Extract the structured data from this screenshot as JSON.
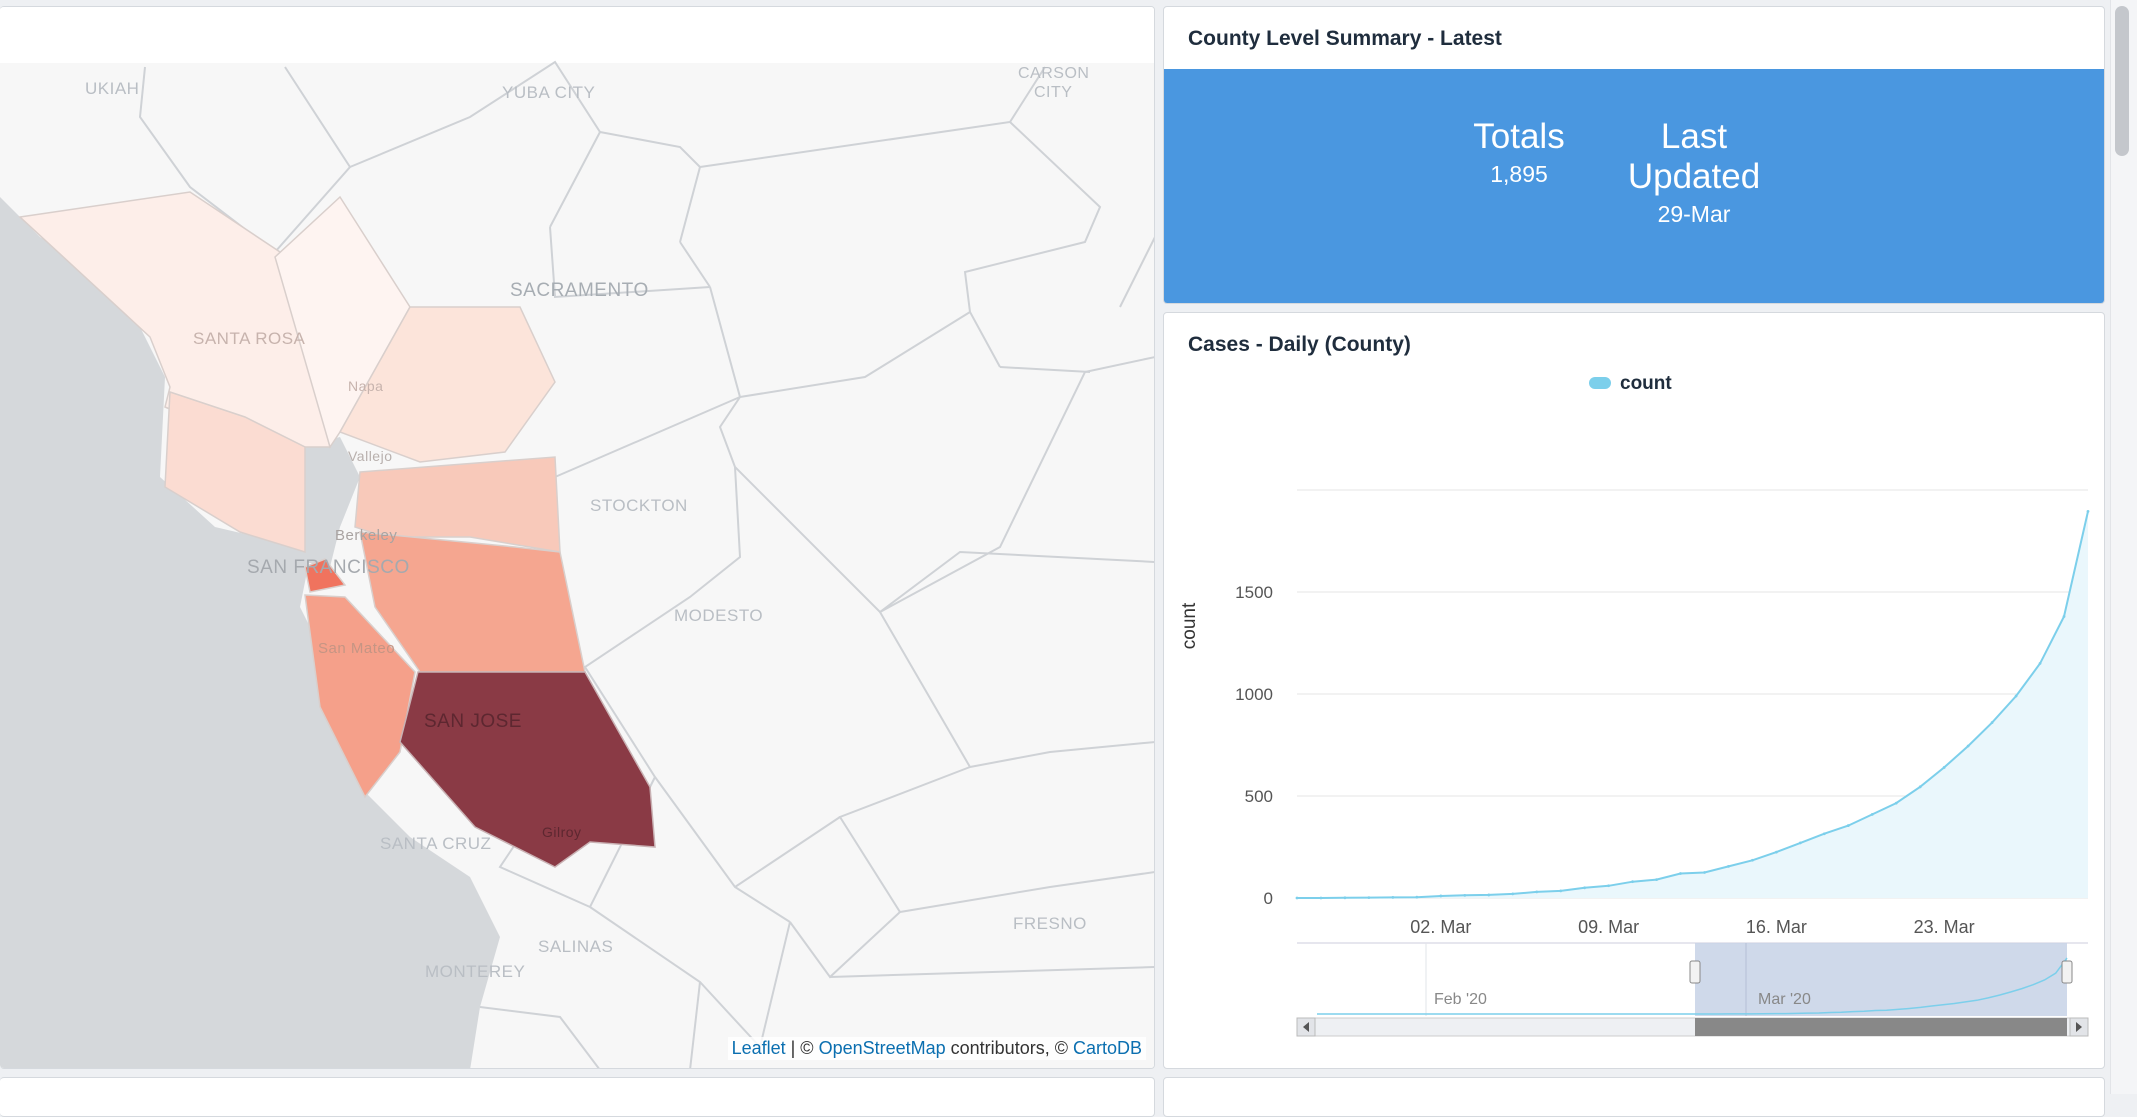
{
  "map": {
    "cities": [
      "UKIAH",
      "YUBA CITY",
      "CARSON",
      "CITY",
      "SACRAMENTO",
      "SANTA ROSA",
      "Napa",
      "Vallejo",
      "Berkeley",
      "SAN FRANCISCO",
      "STOCKTON",
      "MODESTO",
      "San Mateo",
      "SAN JOSE",
      "Gilroy",
      "SANTA CRUZ",
      "SALINAS",
      "MONTEREY",
      "FRESNO"
    ],
    "attribution": {
      "leaflet": "Leaflet",
      "sep1": " | © ",
      "osm": "OpenStreetMap",
      "contrib": " contributors, © ",
      "carto": "CartoDB"
    },
    "colors": {
      "land": "#f7f7f7",
      "water": "#d5d8db",
      "border": "#cfd2d6",
      "lightest": "#fdeee9",
      "light": "#fbdcd2",
      "medium": "#f8c4b4",
      "strong": "#f4a38d",
      "hot": "#f0735e",
      "darkest": "#8a3a45"
    }
  },
  "summary": {
    "title": "County Level Summary - Latest",
    "totals_label": "Totals",
    "totals_value": "1,895",
    "updated_label": "Last Updated",
    "updated_value": "29-Mar",
    "bg_color": "#4a97e0"
  },
  "chart_panel": {
    "title": "Cases - Daily (County)"
  },
  "chart_data": {
    "type": "area",
    "legend": "count",
    "ylabel": "count",
    "ylim": [
      0,
      2000
    ],
    "yticks": [
      0,
      500,
      1000,
      1500
    ],
    "xtick_labels": [
      "02. Mar",
      "09. Mar",
      "16. Mar",
      "23. Mar"
    ],
    "navigator_labels": [
      "Feb '20",
      "Mar '20"
    ],
    "series": [
      {
        "name": "count",
        "color": "#7ccfeb",
        "x": [
          "25-Feb",
          "26-Feb",
          "27-Feb",
          "28-Feb",
          "29-Feb",
          "01-Mar",
          "02-Mar",
          "03-Mar",
          "04-Mar",
          "05-Mar",
          "06-Mar",
          "07-Mar",
          "08-Mar",
          "09-Mar",
          "10-Mar",
          "11-Mar",
          "12-Mar",
          "13-Mar",
          "14-Mar",
          "15-Mar",
          "16-Mar",
          "17-Mar",
          "18-Mar",
          "19-Mar",
          "20-Mar",
          "21-Mar",
          "22-Mar",
          "23-Mar",
          "24-Mar",
          "25-Mar",
          "26-Mar",
          "27-Mar",
          "28-Mar",
          "29-Mar"
        ],
        "values": [
          0,
          0,
          1,
          2,
          3,
          4,
          10,
          13,
          15,
          20,
          30,
          35,
          50,
          60,
          80,
          90,
          120,
          125,
          155,
          185,
          225,
          270,
          315,
          355,
          410,
          465,
          545,
          640,
          745,
          860,
          990,
          1150,
          1380,
          1895
        ]
      }
    ]
  }
}
